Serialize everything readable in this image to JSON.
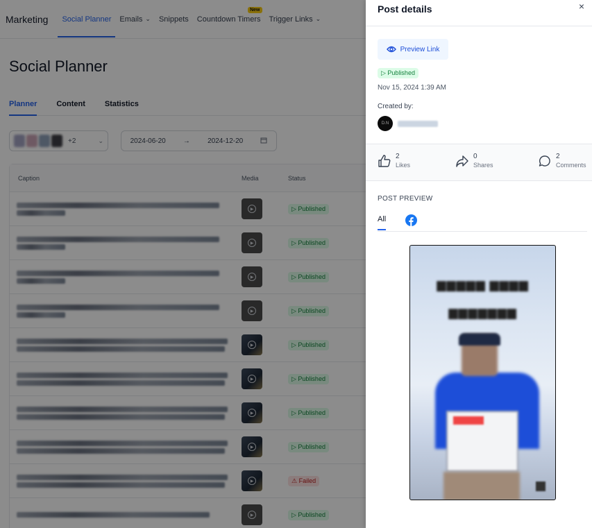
{
  "topnav": {
    "brand": "Marketing",
    "items": [
      {
        "label": "Social Planner",
        "chevron": "",
        "badge": ""
      },
      {
        "label": "Emails",
        "chevron": "⌄",
        "badge": ""
      },
      {
        "label": "Snippets",
        "chevron": "",
        "badge": ""
      },
      {
        "label": "Countdown Timers",
        "chevron": "",
        "badge": "New"
      },
      {
        "label": "Trigger Links",
        "chevron": "⌄",
        "badge": ""
      }
    ]
  },
  "page": {
    "title": "Social Planner",
    "tabs": [
      "Planner",
      "Content",
      "Statistics"
    ]
  },
  "filters": {
    "accounts_more": "+2",
    "date_from": "2024-06-20",
    "date_to": "2024-12-20",
    "arrow": "→"
  },
  "table": {
    "headers": {
      "caption": "Caption",
      "media": "Media",
      "status": "Status"
    },
    "rows": [
      {
        "media": "video",
        "status": "Published"
      },
      {
        "media": "video",
        "status": "Published"
      },
      {
        "media": "video",
        "status": "Published"
      },
      {
        "media": "video",
        "status": "Published"
      },
      {
        "media": "photo",
        "status": "Published"
      },
      {
        "media": "photo",
        "status": "Published"
      },
      {
        "media": "photo",
        "status": "Published"
      },
      {
        "media": "photo",
        "status": "Published"
      },
      {
        "media": "photo",
        "status": "Failed"
      },
      {
        "media": "video",
        "status": "Published"
      }
    ]
  },
  "drawer": {
    "title": "Post details",
    "close": "×",
    "preview_link": "Preview Link",
    "status": "Published",
    "published_at": "Nov 15, 2024 1:39 AM",
    "created_by_label": "Created by:",
    "creator_initials": "D.N",
    "stats": {
      "likes": {
        "count": "2",
        "label": "Likes"
      },
      "shares": {
        "count": "0",
        "label": "Shares"
      },
      "comments": {
        "count": "2",
        "label": "Comments"
      }
    },
    "post_preview": {
      "title": "POST PREVIEW",
      "tab_all": "All",
      "tab_facebook_icon": "facebook-icon"
    }
  },
  "colors": {
    "accent": "#2563eb",
    "success": "#15803d",
    "danger": "#b91c1c",
    "facebook": "#1877f2"
  }
}
